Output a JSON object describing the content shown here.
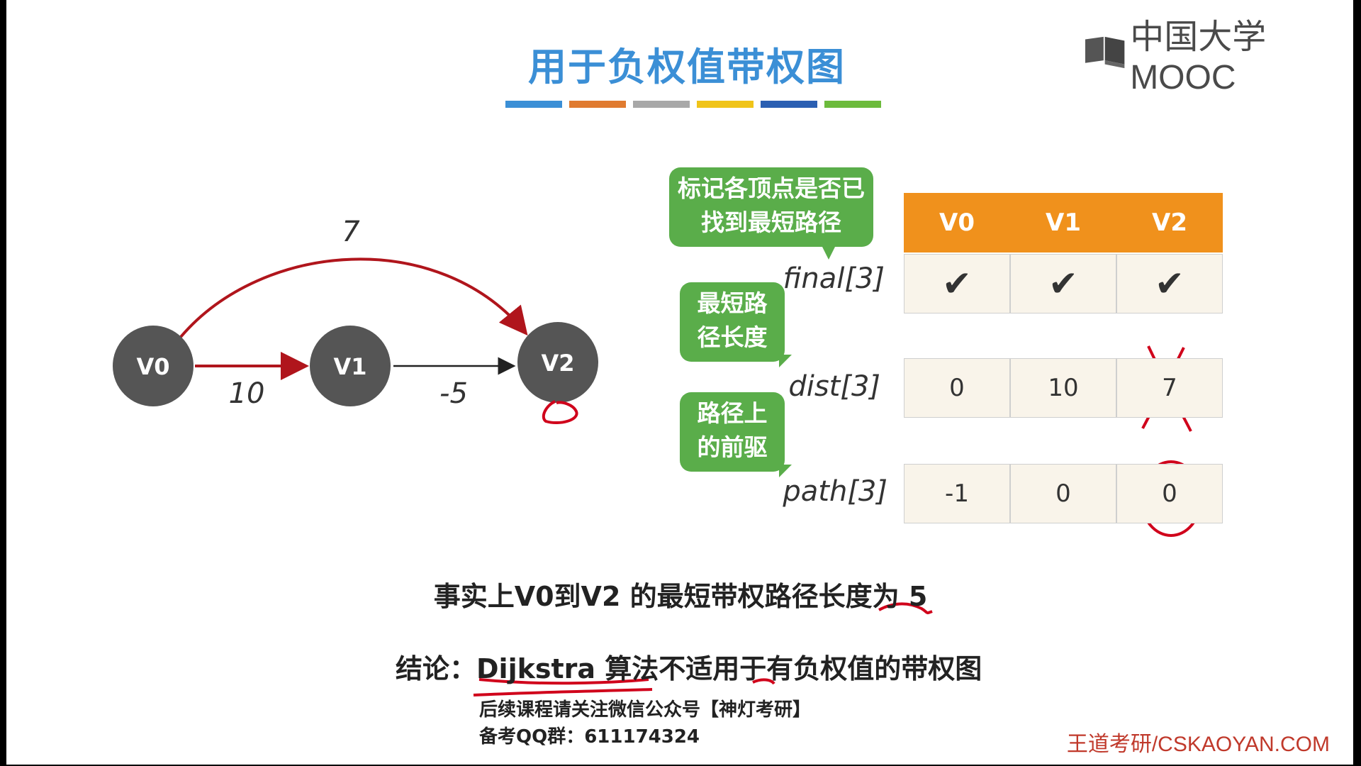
{
  "title": "用于负权值带权图",
  "title_bar_colors": [
    "#3b8fd6",
    "#e07b30",
    "#a8a8a8",
    "#f0c419",
    "#2b5fb2",
    "#6cbb3c"
  ],
  "brand": "中国大学MOOC",
  "graph": {
    "vertices": [
      "V0",
      "V1",
      "V2"
    ],
    "edges": [
      {
        "from": "V0",
        "to": "V1",
        "weight": "10",
        "highlight": true
      },
      {
        "from": "V1",
        "to": "V2",
        "weight": "-5",
        "highlight": false
      },
      {
        "from": "V0",
        "to": "V2",
        "weight": "7",
        "highlight": true
      }
    ]
  },
  "callouts": {
    "final": "标记各顶点是否已找到最短路径",
    "dist": "最短路径长度",
    "path": "路径上的前驱"
  },
  "table": {
    "headers": [
      "V0",
      "V1",
      "V2"
    ],
    "rows": {
      "final": {
        "label": "final[3]",
        "values": [
          "✔",
          "✔",
          "✔"
        ]
      },
      "dist": {
        "label": "dist[3]",
        "values": [
          "0",
          "10",
          "7"
        ]
      },
      "path": {
        "label": "path[3]",
        "values": [
          "-1",
          "0",
          "0"
        ]
      }
    }
  },
  "fact": "事实上V0到V2 的最短带权路径长度为 5",
  "conclusion": {
    "prefix": "结论：",
    "text": "Dijkstra 算法不适用于有负权值的带权图"
  },
  "footer": {
    "line1": "后续课程请关注微信公众号【神灯考研】",
    "line2": "备考QQ群：611174324"
  },
  "watermark": "王道考研/CSKAOYAN.COM",
  "colors": {
    "node_fill": "#555555",
    "highlight_edge": "#b0151c",
    "callout_green": "#5aad4a",
    "header_orange": "#f0911c",
    "annotation_red": "#d0021b"
  }
}
